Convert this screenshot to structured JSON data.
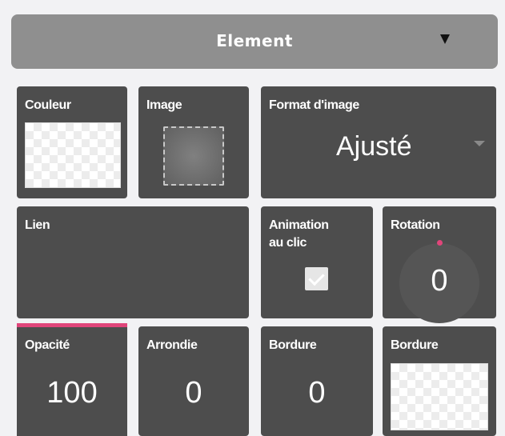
{
  "header": {
    "title": "Element",
    "dropdown_icon": "caret-down-icon"
  },
  "tiles": {
    "couleur": {
      "label": "Couleur"
    },
    "image": {
      "label": "Image"
    },
    "format": {
      "label": "Format d'image",
      "value": "Ajusté"
    },
    "lien": {
      "label": "Lien"
    },
    "animation": {
      "label_line1": "Animation",
      "label_line2": "au clic",
      "checked": true
    },
    "rotation": {
      "label": "Rotation",
      "value": "0"
    },
    "opacite": {
      "label": "Opacité",
      "value": "100"
    },
    "arrondie": {
      "label": "Arrondie",
      "value": "0"
    },
    "bordure_width": {
      "label": "Bordure",
      "value": "0"
    },
    "bordure_color": {
      "label": "Bordure"
    }
  },
  "colors": {
    "tile_bg": "#4d4d4d",
    "header_bg": "#8f8f8f",
    "accent": "#e0457a",
    "page_bg": "#f2f2f4"
  }
}
